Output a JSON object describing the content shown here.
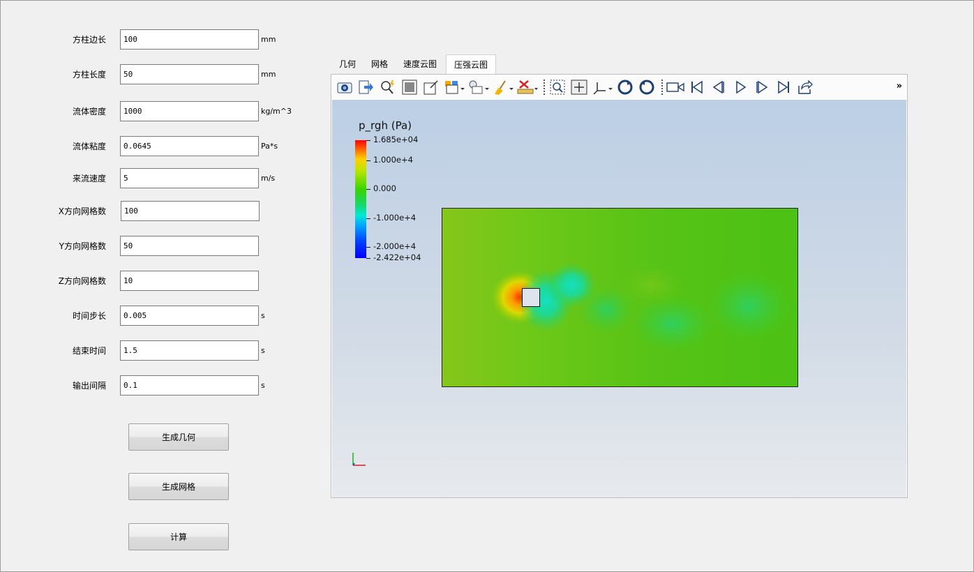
{
  "form": {
    "fields": [
      {
        "label": "方柱边长",
        "value": "100",
        "unit": "mm"
      },
      {
        "label": "方柱长度",
        "value": "50",
        "unit": "mm"
      },
      {
        "label": "流体密度",
        "value": "1000",
        "unit": "kg/m^3"
      },
      {
        "label": "流体粘度",
        "value": "0.0645",
        "unit": "Pa*s"
      },
      {
        "label": "来流速度",
        "value": "5",
        "unit": "m/s"
      },
      {
        "label": "X方向网格数",
        "value": "100",
        "unit": ""
      },
      {
        "label": "Y方向网格数",
        "value": "50",
        "unit": ""
      },
      {
        "label": "Z方向网格数",
        "value": "10",
        "unit": ""
      },
      {
        "label": "时间步长",
        "value": "0.005",
        "unit": "s"
      },
      {
        "label": "结束时间",
        "value": "1.5",
        "unit": "s"
      },
      {
        "label": "输出间隔",
        "value": "0.1",
        "unit": "s"
      }
    ],
    "buttons": {
      "generate_geometry": "生成几何",
      "generate_mesh": "生成网格",
      "compute": "计算"
    }
  },
  "tabs": [
    {
      "label": "几何",
      "active": false
    },
    {
      "label": "网格",
      "active": false
    },
    {
      "label": "速度云图",
      "active": false
    },
    {
      "label": "压强云图",
      "active": true
    }
  ],
  "toolbar": {
    "icons": [
      "camera-icon",
      "export-icon",
      "zoom-to-data-icon",
      "reset-view-icon",
      "orient-axes-icon",
      "layout-icon",
      "light-icon",
      "clean-icon",
      "ruler-icon",
      "zoom-box-icon",
      "pan-box-icon",
      "axes-orientation-icon",
      "rotate-cw-icon",
      "rotate-ccw-icon",
      "camera-record-icon",
      "first-frame-icon",
      "previous-frame-icon",
      "play-icon",
      "next-frame-icon",
      "last-frame-icon",
      "loop-icon"
    ],
    "more": "»"
  },
  "scalar_bar": {
    "title": "p_rgh (Pa)",
    "labels": [
      "1.685e+04",
      "1.000e+4",
      "0.000",
      "-1.000e+4",
      "-2.000e+4",
      "-2.422e+04"
    ],
    "range": [
      -24220,
      16850
    ],
    "colors": [
      "#ff0000",
      "#ffd000",
      "#38d400",
      "#00e8d8",
      "#0000ff"
    ]
  }
}
